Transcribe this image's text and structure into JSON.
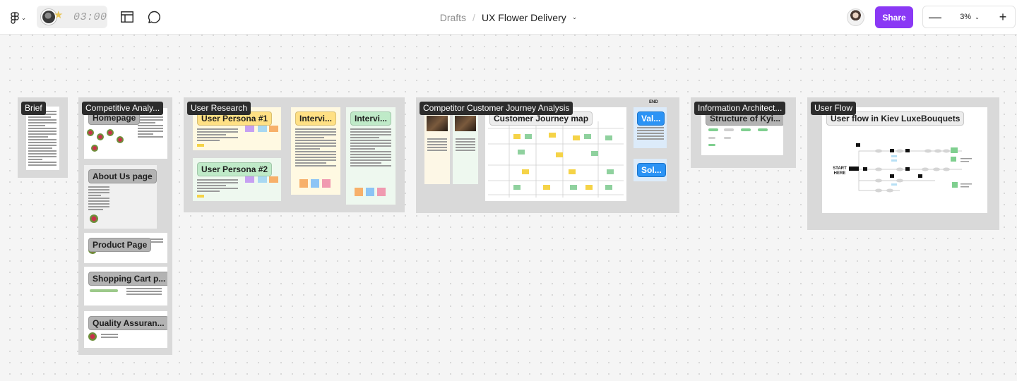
{
  "topbar": {
    "timer": "03:00",
    "breadcrumb_parent": "Drafts",
    "breadcrumb_separator": "/",
    "file_name": "UX Flower Delivery",
    "share_label": "Share",
    "zoom": "3%",
    "zoom_minus": "—",
    "zoom_plus": "+"
  },
  "colors": {
    "accent": "#8a38f5",
    "section_bg": "#d9d9d9",
    "label_bg": "#2c2c2c"
  },
  "icons": [
    "figma-menu-icon",
    "timer-avatar-icon",
    "star-icon",
    "layout-icon",
    "comment-icon",
    "chevron-down-icon"
  ],
  "sections": {
    "brief": {
      "title": "Brief"
    },
    "competitive": {
      "title": "Competitive Analy...",
      "frames": [
        "Homepage",
        "About Us page",
        "Product Page",
        "Shopping Cart p...",
        "Quality Assuran..."
      ]
    },
    "user_research": {
      "title": "User Research",
      "frames": [
        "User Persona #1",
        "User Persona #2",
        "Intervi...",
        "Intervi..."
      ]
    },
    "journey": {
      "title": "Competitor Customer Journey Analysis",
      "map_title": "Customer Journey map",
      "end_label": "END",
      "frames": [
        "Val...",
        "Sol..."
      ]
    },
    "info_arch": {
      "title": "Information Architect...",
      "frame": "Structure of Kyi..."
    },
    "user_flow": {
      "title": "User Flow",
      "frame": "User flow in Kiev LuxeBouquets",
      "start_label": "START HERE"
    }
  }
}
